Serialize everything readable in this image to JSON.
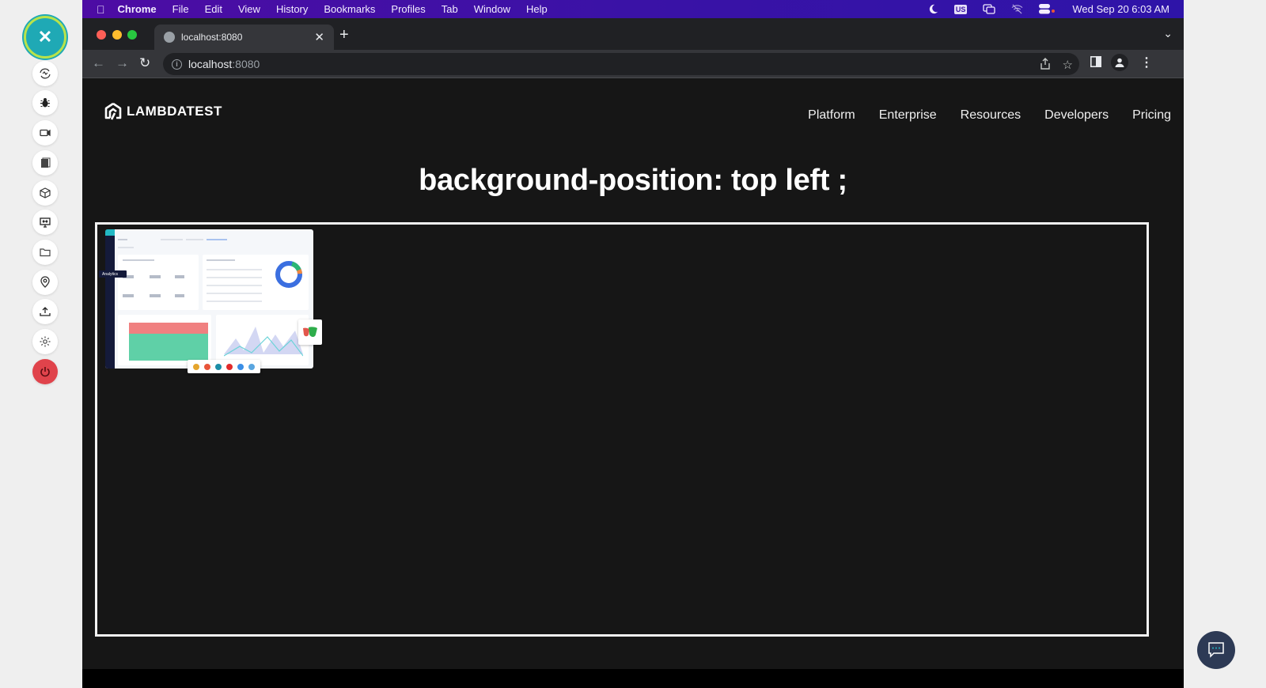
{
  "lt_toolbar": {
    "close_icon": "close-icon",
    "tools": [
      {
        "name": "network-throttle",
        "icon": "network-icon"
      },
      {
        "name": "debug",
        "icon": "bug-icon"
      },
      {
        "name": "record-video",
        "icon": "video-icon"
      },
      {
        "name": "screenshot",
        "icon": "gallery-icon"
      },
      {
        "name": "3d-view",
        "icon": "cube-icon"
      },
      {
        "name": "resolution",
        "icon": "monitor-resize-icon"
      },
      {
        "name": "files",
        "icon": "folder-icon"
      },
      {
        "name": "geolocation",
        "icon": "location-pin-icon"
      },
      {
        "name": "upload",
        "icon": "upload-icon"
      },
      {
        "name": "settings",
        "icon": "gear-icon"
      },
      {
        "name": "end-session",
        "icon": "power-icon"
      }
    ],
    "accent": "#1fa9b5",
    "ring": "#b9e34a",
    "power_color": "#e0434b"
  },
  "menubar": {
    "app": "Chrome",
    "items": [
      "File",
      "Edit",
      "View",
      "History",
      "Bookmarks",
      "Profiles",
      "Tab",
      "Window",
      "Help"
    ],
    "input_source": "US",
    "datetime": "Wed Sep 20  6:03 AM",
    "color": "#3a12a6"
  },
  "browser": {
    "tab_title": "localhost:8080",
    "url_host": "localhost",
    "url_port": ":8080"
  },
  "site": {
    "logo_text": "LAMBDATEST",
    "nav": [
      "Platform",
      "Enterprise",
      "Resources",
      "Developers",
      "Pricing"
    ],
    "heading": "background-position: top left ;"
  },
  "dashboard_image": {
    "sidebar_tag": "Analytics"
  }
}
